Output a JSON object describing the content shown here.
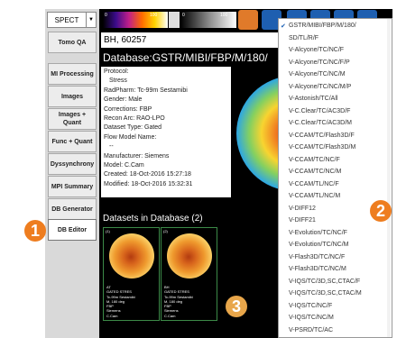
{
  "modality": {
    "label": "SPECT",
    "dropdown_icon": "triangle-down-icon"
  },
  "sidebar": {
    "items": [
      {
        "label": "Tomo QA"
      },
      {
        "label": "MI Processing"
      },
      {
        "label": "Images"
      },
      {
        "label": "Images + Quant"
      },
      {
        "label": "Func + Quant"
      },
      {
        "label": "Dyssynchrony"
      },
      {
        "label": "MPI Summary"
      },
      {
        "label": "DB Generator"
      },
      {
        "label": "DB Editor",
        "selected": true
      }
    ]
  },
  "toolbar": {
    "colorbar1_ticks": [
      "0",
      "100"
    ],
    "colorbar2_ticks": [
      "0",
      "100"
    ],
    "icon_colors": [
      "#e07a2a",
      "#1e5fb0"
    ]
  },
  "patient": {
    "id": "BH, 60257"
  },
  "database": {
    "title": "Database:GSTR/MIBI/FBP/M/180/",
    "metadata": [
      "Protocol:",
      "  Stress",
      "RadPharm: Tc-99m Sestamibi",
      "Gender: Male",
      "Corrections: FBP",
      "Recon Arc: RAO-LPO",
      "Dataset Type: Gated",
      "Flow Model Name:",
      "  --",
      "Manufacturer: Siemens",
      "Model: C.Cam",
      "Created: 18-Oct-2016 15:27:18",
      "Modified: 18-Oct-2016 15:32:31"
    ]
  },
  "datasets": {
    "header": "Datasets in Database (2)",
    "cards": [
      {
        "number": "(1)",
        "caption": [
          "AT",
          "GATED STRES",
          "Tc-99m Sestamibi",
          "M, 180 deg",
          "FBP",
          "Siemens",
          "C.Cam"
        ]
      },
      {
        "number": "(2)",
        "caption": [
          "BH",
          "GATED STRES",
          "Tc-99m Sestamibi",
          "M, 180 deg",
          "FBP",
          "Siemens",
          "C.Cam"
        ]
      }
    ]
  },
  "db_menu": {
    "selected_index": 0,
    "items": [
      "GSTR/MIBI/FBP/M/180/",
      "SD/TL/R/F",
      "V-Alcyone/TC/NC/F",
      "V-Alcyone/TC/NC/F/P",
      "V-Alcyone/TC/NC/M",
      "V-Alcyone/TC/NC/M/P",
      "V-Astonish/TC/All",
      "V-C.Clear/TC/AC3D/F",
      "V-C.Clear/TC/AC3D/M",
      "V-CCAM/TC/Flash3D/F",
      "V-CCAM/TC/Flash3D/M",
      "V-CCAM/TC/NC/F",
      "V-CCAM/TC/NC/M",
      "V-CCAM/TL/NC/F",
      "V-CCAM/TL/NC/M",
      "V-DIFF12",
      "V-DIFF21",
      "V-Evolution/TC/NC/F",
      "V-Evolution/TC/NC/M",
      "V-Flash3D/TC/NC/F",
      "V-Flash3D/TC/NC/M",
      "V-IQS/TC/3D,SC,CTAC/F",
      "V-IQS/TC/3D,SC,CTAC/M",
      "V-IQS/TC/NC/F",
      "V-IQS/TC/NC/M",
      "V-PSRD/TC/AC"
    ]
  },
  "callouts": [
    {
      "label": "1",
      "color": "#ee7d1f"
    },
    {
      "label": "2",
      "color": "#ee7d1f"
    },
    {
      "label": "3",
      "color": "#e8a64a"
    }
  ]
}
